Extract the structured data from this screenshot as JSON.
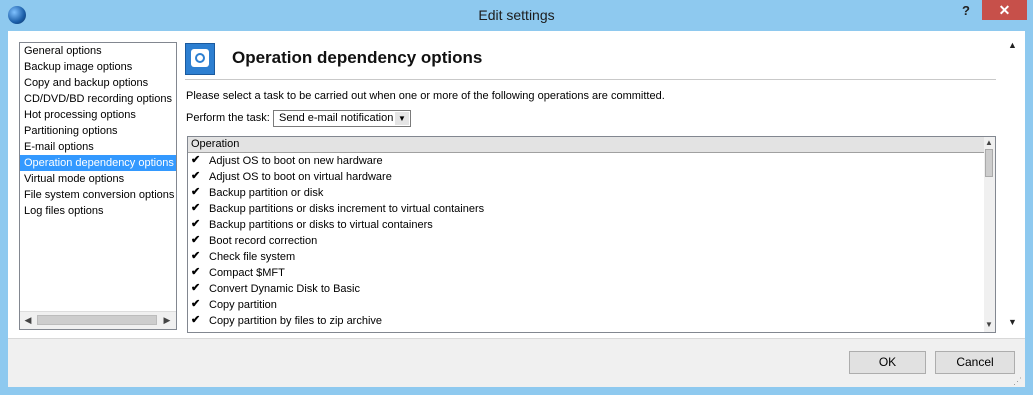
{
  "window": {
    "title": "Edit settings",
    "help_label": "?",
    "close_label": "✕"
  },
  "nav": {
    "items": [
      {
        "label": "General options",
        "selected": false
      },
      {
        "label": "Backup image options",
        "selected": false
      },
      {
        "label": "Copy and backup options",
        "selected": false
      },
      {
        "label": "CD/DVD/BD recording options",
        "selected": false
      },
      {
        "label": "Hot processing options",
        "selected": false
      },
      {
        "label": "Partitioning options",
        "selected": false
      },
      {
        "label": "E-mail options",
        "selected": false
      },
      {
        "label": "Operation dependency options",
        "selected": true
      },
      {
        "label": "Virtual mode options",
        "selected": false
      },
      {
        "label": "File system conversion options",
        "selected": false
      },
      {
        "label": "Log files options",
        "selected": false
      }
    ]
  },
  "section": {
    "title": "Operation dependency options",
    "instruction": "Please select a task to be carried out when one or more of the following operations are committed.",
    "task_label": "Perform the task:",
    "task_value": "Send e-mail notification"
  },
  "list": {
    "column_header": "Operation",
    "rows": [
      {
        "label": "Adjust OS to boot on new hardware",
        "checked": true
      },
      {
        "label": "Adjust OS to boot on virtual hardware",
        "checked": true
      },
      {
        "label": "Backup partition or disk",
        "checked": true
      },
      {
        "label": "Backup partitions or disks increment to virtual containers",
        "checked": true
      },
      {
        "label": "Backup partitions or disks to virtual containers",
        "checked": true
      },
      {
        "label": "Boot record correction",
        "checked": true
      },
      {
        "label": "Check file system",
        "checked": true
      },
      {
        "label": "Compact $MFT",
        "checked": true
      },
      {
        "label": "Convert Dynamic Disk to Basic",
        "checked": true
      },
      {
        "label": "Copy partition",
        "checked": true
      },
      {
        "label": "Copy partition by files to zip archive",
        "checked": true
      }
    ]
  },
  "buttons": {
    "ok": "OK",
    "cancel": "Cancel"
  }
}
